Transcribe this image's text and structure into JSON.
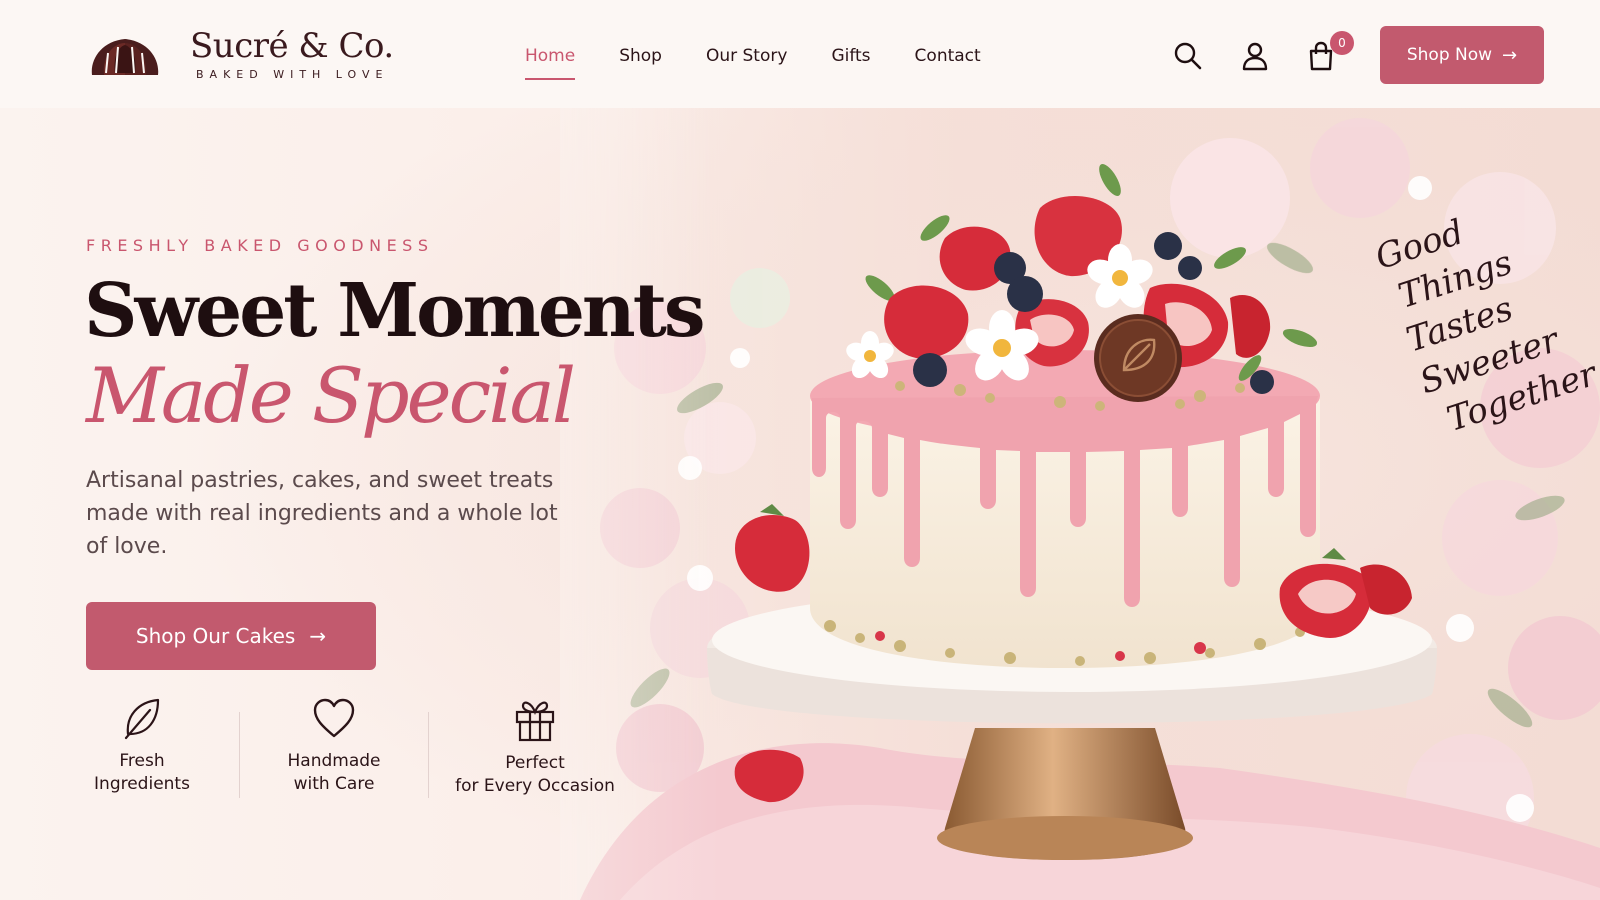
{
  "brand": {
    "name": "Sucré & Co.",
    "tagline": "BAKED WITH LOVE"
  },
  "nav": {
    "items": [
      {
        "label": "Home",
        "active": true
      },
      {
        "label": "Shop",
        "active": false
      },
      {
        "label": "Our Story",
        "active": false
      },
      {
        "label": "Gifts",
        "active": false
      },
      {
        "label": "Contact",
        "active": false
      }
    ]
  },
  "header_actions": {
    "icons": [
      "search-icon",
      "account-icon",
      "cart-icon"
    ],
    "cart_count": "0",
    "shop_now_label": "Shop Now",
    "arrow": "→"
  },
  "hero": {
    "eyebrow": "FRESHLY BAKED GOODNESS",
    "title_line1": "Sweet Moments",
    "title_line2": "Made Special",
    "subtitle": "Artisanal pastries, cakes, and sweet treats made with real ingredients and a whole lot of love.",
    "cta_label": "Shop Our Cakes",
    "cta_arrow": "→",
    "script_lines": [
      "Good",
      "Things",
      "Tastes Sweeter",
      "Together ♡"
    ]
  },
  "features": [
    {
      "icon": "leaf-icon",
      "line1": "Fresh",
      "line2": "Ingredients"
    },
    {
      "icon": "heart-icon",
      "line1": "Handmade",
      "line2": "with Care"
    },
    {
      "icon": "gift-icon",
      "line1": "Perfect",
      "line2": "for Every Occasion"
    }
  ],
  "colors": {
    "accent": "#c9566e",
    "button": "#c25a6e",
    "text_dark": "#1e0e10",
    "background": "#fbf6f2"
  }
}
